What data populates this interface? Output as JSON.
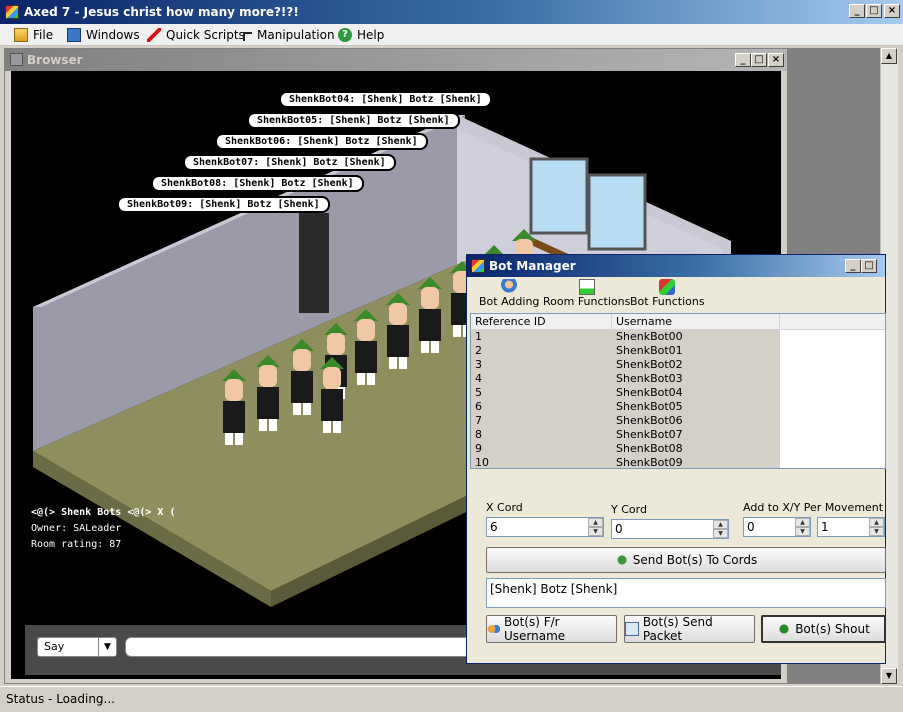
{
  "window": {
    "title": "Axed 7 - Jesus christ how many more?!?!"
  },
  "menu": [
    "File",
    "Windows",
    "Quick Scripts",
    "Manipulation",
    "Help"
  ],
  "browser": {
    "title": "Browser",
    "speech": [
      "ShenkBot04: [Shenk] Botz [Shenk]",
      "ShenkBot05: [Shenk] Botz [Shenk]",
      "ShenkBot06: [Shenk] Botz [Shenk]",
      "ShenkBot07: [Shenk] Botz [Shenk]",
      "ShenkBot08: [Shenk] Botz [Shenk]",
      "ShenkBot09: [Shenk] Botz [Shenk]"
    ],
    "room_name": "<@(> Shenk Bots <@(> X (",
    "owner": "Owner: SALeader",
    "rating": "Room rating: 87",
    "chat_mode": "Say"
  },
  "botmgr": {
    "title": "Bot Manager",
    "toolbar": [
      "Bot Adding",
      "Room Functions",
      "Bot Functions"
    ],
    "columns": [
      "Reference ID",
      "Username"
    ],
    "rows": [
      [
        "1",
        "ShenkBot00"
      ],
      [
        "2",
        "ShenkBot01"
      ],
      [
        "3",
        "ShenkBot02"
      ],
      [
        "4",
        "ShenkBot03"
      ],
      [
        "5",
        "ShenkBot04"
      ],
      [
        "6",
        "ShenkBot05"
      ],
      [
        "7",
        "ShenkBot06"
      ],
      [
        "8",
        "ShenkBot07"
      ],
      [
        "9",
        "ShenkBot08"
      ],
      [
        "10",
        "ShenkBot09"
      ]
    ],
    "x_label": "X Cord",
    "y_label": "Y Cord",
    "add_label": "Add to X/Y Per Movement",
    "x_value": "6",
    "y_value": "0",
    "add_x": "0",
    "add_y": "1",
    "send_cords": "Send Bot(s) To Cords",
    "message": "[Shenk] Botz [Shenk]",
    "btn_fr": "Bot(s) F/r Username",
    "btn_packet": "Bot(s) Send Packet",
    "btn_shout": "Bot(s) Shout"
  },
  "status": "Status -  Loading..."
}
